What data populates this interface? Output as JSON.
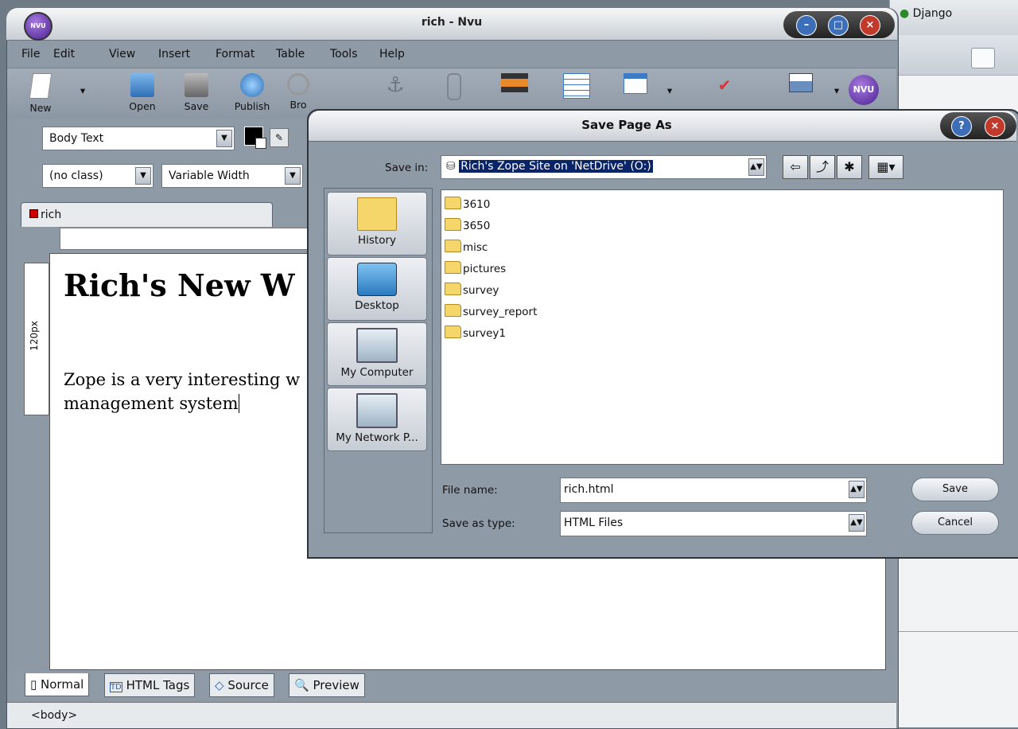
{
  "background_window": {
    "tab_label": "Django"
  },
  "window": {
    "title": "rich - Nvu",
    "app_icon_text": "NVU"
  },
  "menu": [
    "File",
    "Edit",
    "View",
    "Insert",
    "Format",
    "Table",
    "Tools",
    "Help"
  ],
  "toolbar": {
    "new": "New",
    "open": "Open",
    "save": "Save",
    "publish": "Publish",
    "browse": "Bro",
    "nvu_badge": "NVU"
  },
  "format": {
    "paragraph_style": "Body Text",
    "class": "(no class)",
    "font": "Variable Width"
  },
  "doc_tab": "rich",
  "ruler_label": "120px",
  "document": {
    "heading": "Rich's New W",
    "paragraph": "Zope is a very interesting w",
    "paragraph2": "management system"
  },
  "mode_tabs": [
    "Normal",
    "HTML Tags",
    "Source",
    "Preview"
  ],
  "status_text": "<body>",
  "dialog": {
    "title": "Save Page As",
    "save_in_label": "Save in:",
    "save_in_value": "Rich's Zope Site on 'NetDrive' (O:)",
    "places": [
      "History",
      "Desktop",
      "My Computer",
      "My Network P..."
    ],
    "folders": [
      "3610",
      "3650",
      "misc",
      "pictures",
      "survey",
      "survey_report",
      "survey1"
    ],
    "file_name_label": "File name:",
    "file_name_value": "rich.html",
    "save_as_type_label": "Save as type:",
    "save_as_type_value": "HTML Files",
    "save_button": "Save",
    "cancel_button": "Cancel"
  }
}
